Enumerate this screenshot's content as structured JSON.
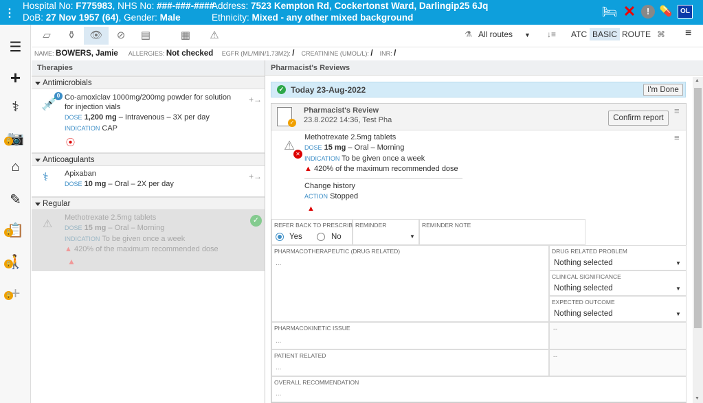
{
  "patient": {
    "hospital_label": "Hospital No: ",
    "hospital_no": "F775983",
    "nhs_label": ", NHS No: ",
    "nhs_no": "###-###-####",
    "dob_label": "DoB: ",
    "dob": "27 Nov 1957 (64)",
    "gender_label": ", Gender: ",
    "gender": "Male",
    "address_label": "Address: ",
    "address": "7523 Kempton Rd, Cockertonst Ward, Darlingip25 6Jq",
    "ethnicity_label": "Ethnicity: ",
    "ethnicity": "Mixed - any other mixed background",
    "user_initials": "OL"
  },
  "toolbar": {
    "routes": "All routes",
    "atc": "ATC",
    "basic": "BASIC",
    "route": "ROUTE"
  },
  "info": {
    "name_label": "NAME:",
    "name": "BOWERS, Jamie",
    "allergies_label": "ALLERGIES:",
    "allergies": "Not checked",
    "egfr_label": "EGFR (ML/MIN/1.73M2):",
    "egfr": "/",
    "creat_label": "CREATININE (UMOL/L):",
    "creat": "/",
    "inr_label": "INR:",
    "inr": "/"
  },
  "therapies": {
    "title": "Therapies",
    "groups": [
      {
        "name": "Antimicrobials"
      },
      {
        "name": "Anticoagulants"
      },
      {
        "name": "Regular"
      }
    ],
    "meds": [
      {
        "name": "Co-amoxiclav 1000mg/200mg powder for solution for injection vials",
        "dose_label": "DOSE",
        "dose": "1,200 mg",
        "dose_rest": " – Intravenous – 3X per day",
        "ind_label": "INDICATION",
        "ind": "CAP",
        "badge": "0"
      },
      {
        "name": "Apixaban",
        "dose_label": "DOSE",
        "dose": "10 mg",
        "dose_rest": " – Oral – 2X per day"
      },
      {
        "name": "Methotrexate 2.5mg tablets",
        "dose_label": "DOSE",
        "dose": "15 mg",
        "dose_rest": " – Oral – Morning",
        "ind_label": "INDICATION",
        "ind": "To be given once a week",
        "warning": "420% of the maximum recommended dose"
      }
    ]
  },
  "reviews": {
    "title": "Pharmacist's Reviews",
    "today": "Today 23-Aug-2022",
    "done": "I'm Done",
    "review_title": "Pharmacist's Review",
    "review_meta": "23.8.2022 14:36, Test Pha",
    "confirm": "Confirm report",
    "med_name": "Methotrexate 2.5mg tablets",
    "dose_label": "DOSE",
    "dose": "15 mg",
    "dose_rest": " – Oral – Morning",
    "ind_label": "INDICATION",
    "ind": "To be given once a week",
    "warning": "420% of the maximum recommended dose",
    "change_history": "Change history",
    "action_label": "ACTION",
    "action": "Stopped",
    "refer_back": "REFER BACK TO PRESCRIBER",
    "yes": "Yes",
    "no": "No",
    "reminder": "REMINDER",
    "reminder_note": "REMINDER NOTE",
    "pharmacotherapeutic": "PHARMACOTHERAPEUTIC (DRUG RELATED)",
    "ellipsis": "...",
    "dash": "--",
    "drug_problem": "DRUG RELATED PROBLEM",
    "clinical_significance": "CLINICAL SIGNIFICANCE",
    "expected_outcome": "EXPECTED OUTCOME",
    "nothing_selected": "Nothing selected",
    "pharmacokinetic": "PHARMACOKINETIC ISSUE",
    "patient_related": "PATIENT RELATED",
    "overall": "OVERALL RECOMMENDATION"
  },
  "colors": {
    "topbar": "#0e9fdc",
    "accent": "#3e8fc7",
    "warning": "#dd0000",
    "ok": "#2ea84a",
    "lock": "#f0a000"
  }
}
